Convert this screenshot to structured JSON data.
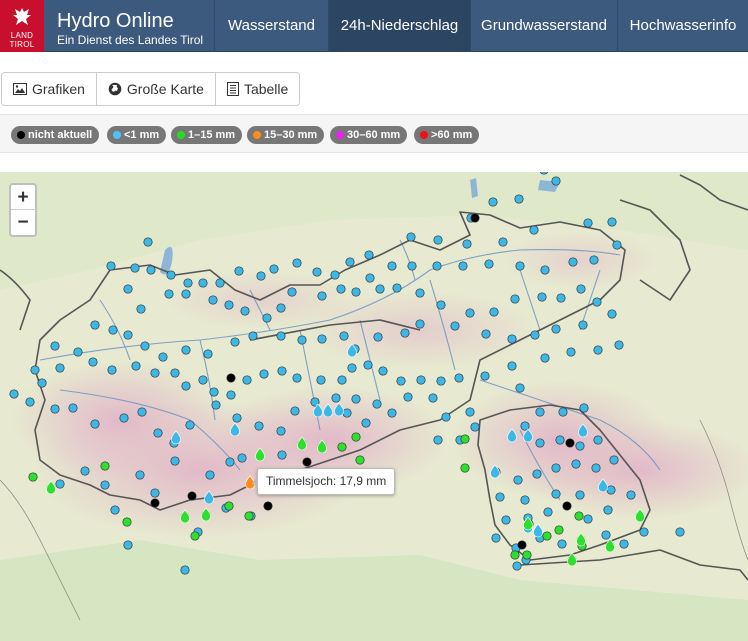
{
  "brand": {
    "title": "Hydro Online",
    "subtitle": "Ein Dienst des Landes Tirol",
    "logo_text": [
      "LAND",
      "TIROL"
    ]
  },
  "nav": [
    {
      "label": "Wasserstand",
      "active": false
    },
    {
      "label": "24h-Niederschlag",
      "active": true
    },
    {
      "label": "Grundwasserstand",
      "active": false
    },
    {
      "label": "Hochwasserinfo",
      "active": false
    }
  ],
  "toolbar": {
    "grafiken": "Grafiken",
    "karte": "Große Karte",
    "tabelle": "Tabelle"
  },
  "legend": [
    {
      "label": "nicht aktuell",
      "color": "#000000"
    },
    {
      "label": "<1 mm",
      "color": "#4fc3f7"
    },
    {
      "label": "1–15 mm",
      "color": "#22dd22"
    },
    {
      "label": "15–30 mm",
      "color": "#ff8c1a"
    },
    {
      "label": "30–60 mm",
      "color": "#ee22ee"
    },
    {
      "label": ">60 mm",
      "color": "#ee1111"
    }
  ],
  "map": {
    "zoom_in": "+",
    "zoom_out": "−",
    "tooltip": "Timmelsjoch: 17,9 mm",
    "colors": {
      "none": "#000000",
      "lt1": "#3cb8e8",
      "lt15": "#2ee02e",
      "lt30": "#ff8c1a"
    }
  }
}
